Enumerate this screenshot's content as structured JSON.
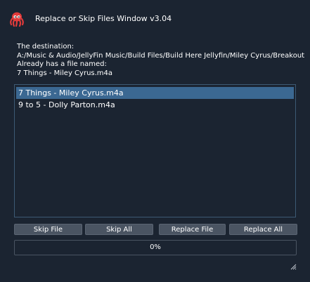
{
  "window": {
    "title": "Replace or Skip Files Window v3.04",
    "icon": "octopus-icon"
  },
  "message": {
    "line1": "The destination:",
    "line2": "A:/Music & Audio/JellyFin Music/Build Files/Build Here Jellyfin/Miley Cyrus/Breakout",
    "line3": "Already has a file named:",
    "line4": "7 Things - Miley Cyrus.m4a"
  },
  "file_list": {
    "items": [
      {
        "label": "7 Things - Miley Cyrus.m4a",
        "selected": true
      },
      {
        "label": "9 to 5 - Dolly Parton.m4a",
        "selected": false
      }
    ]
  },
  "buttons": {
    "skip_file": "Skip File",
    "skip_all": "Skip All",
    "replace_file": "Replace File",
    "replace_all": "Replace All"
  },
  "progress": {
    "value": 0,
    "label": "0%"
  },
  "colors": {
    "background": "#1b2431",
    "selection": "#3b6892",
    "button": "#4a5462",
    "icon": "#e23b3b"
  }
}
